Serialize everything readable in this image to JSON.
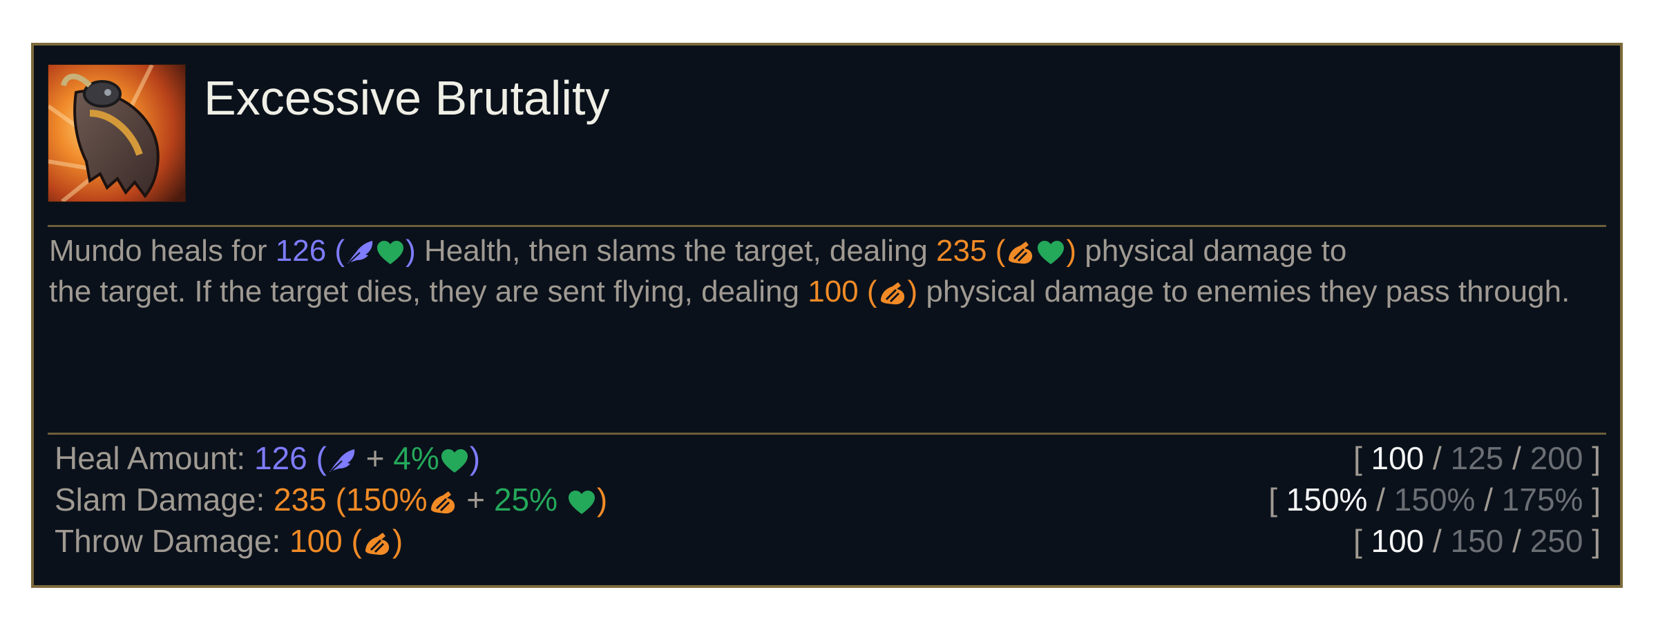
{
  "ability": {
    "title": "Excessive Brutality",
    "icon": "brutality-cleaver-icon"
  },
  "description": {
    "line1": {
      "pre": "Mundo heals for ",
      "heal_value": "126",
      "open": " (",
      "close": ")",
      "mid": " Health, then slams the target, dealing  ",
      "slam_value": "235",
      "post": " physical damage to"
    },
    "line2": {
      "pre": "the target. If the target dies, they are sent flying, dealing ",
      "throw_value": "100",
      "open": " (",
      "close": ")",
      "post": " physical damage to enemies they pass through."
    }
  },
  "stats": [
    {
      "label": "Heal Amount: ",
      "value": "126",
      "open": " (",
      "plus": " + ",
      "scale2": "4%",
      "close": ")",
      "ranks": {
        "open": "[ ",
        "r1": "100",
        "sep1": " / ",
        "r2": "125",
        "sep2": " / ",
        "r3": "200",
        "close": " ]"
      }
    },
    {
      "label": "Slam Damage: ",
      "value": "235",
      "open": " (",
      "scale1": "150%",
      "plus": " + ",
      "scale2": "25% ",
      "close": ")",
      "ranks": {
        "open": "[ ",
        "r1": "150%",
        "sep1": " / ",
        "r2": "150%",
        "sep2": " / ",
        "r3": "175%",
        "close": " ]"
      }
    },
    {
      "label": "Throw Damage: ",
      "value": "100",
      "open": " (",
      "close": ")",
      "ranks": {
        "open": "[ ",
        "r1": "100",
        "sep1": " / ",
        "r2": "150",
        "sep2": " / ",
        "r3": "250",
        "close": " ]"
      }
    }
  ],
  "colors": {
    "ability_power": "#7f7cff",
    "attack_damage": "#f28b26",
    "health": "#24a85a",
    "border": "#7c6a3c",
    "background": "#0a111b"
  },
  "icons": {
    "ability_power": "ability-power-icon",
    "attack_damage": "attack-damage-icon",
    "health": "health-heart-icon"
  }
}
